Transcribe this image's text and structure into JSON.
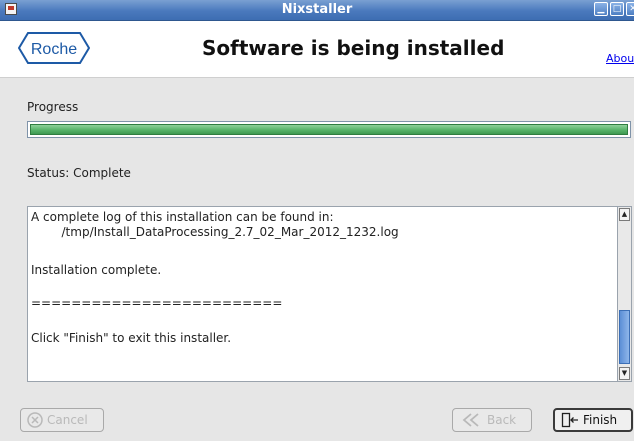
{
  "window": {
    "title": "Nixstaller",
    "controls": [
      "minimize",
      "maximize",
      "close"
    ]
  },
  "header": {
    "logo_text": "Roche",
    "title": "Software is being installed",
    "about_link": "Abou"
  },
  "progress": {
    "label": "Progress",
    "value": 1.0
  },
  "status": {
    "text": "Status: Complete"
  },
  "log": {
    "lines": [
      "A complete log of this installation can be found in:",
      "        /tmp/Install_DataProcessing_2.7_02_Mar_2012_1232.log",
      "",
      "Installation complete.",
      "",
      "=========================",
      "",
      "Click \"Finish\" to exit this installer."
    ]
  },
  "buttons": {
    "cancel": "Cancel",
    "back": "Back",
    "finish": "Finish"
  },
  "colors": {
    "titlebar": "#4a79bd",
    "progress_fill": "#58b36a",
    "logo_blue": "#1d5aa6"
  }
}
